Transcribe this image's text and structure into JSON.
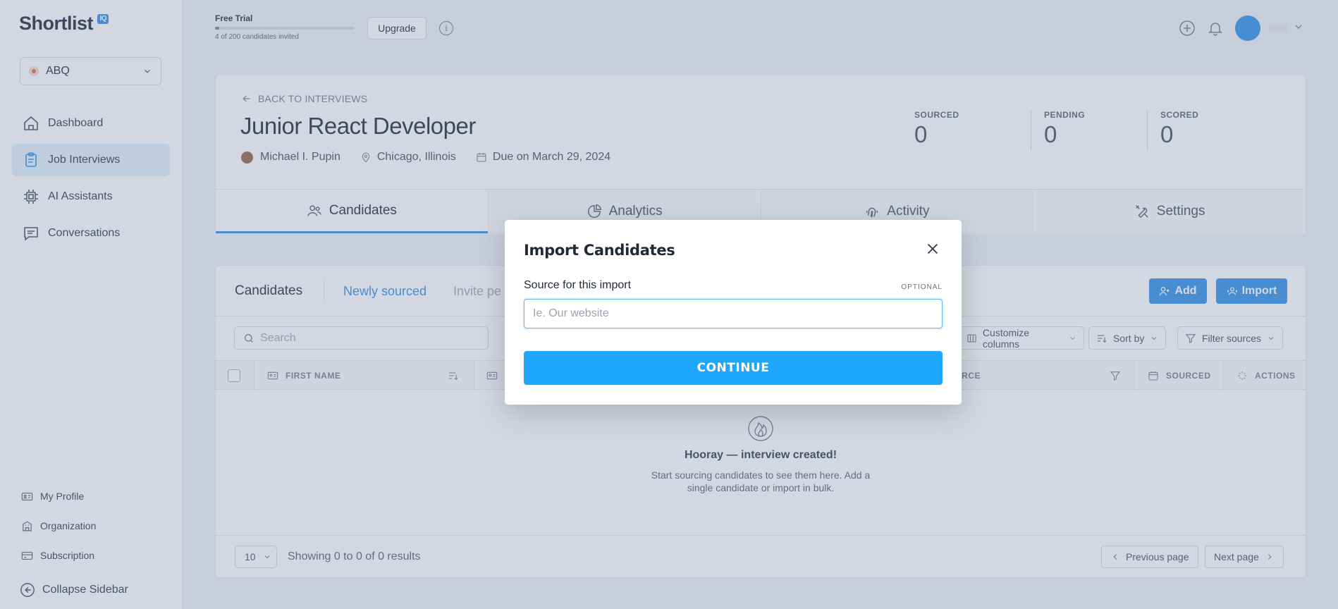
{
  "brand": {
    "name": "Shortlist",
    "badge": "IQ"
  },
  "org": {
    "name": "ABQ"
  },
  "sidebar": {
    "items": [
      {
        "label": "Dashboard",
        "icon": "home-icon"
      },
      {
        "label": "Job Interviews",
        "icon": "clipboard-icon",
        "active": true
      },
      {
        "label": "AI Assistants",
        "icon": "chip-icon"
      },
      {
        "label": "Conversations",
        "icon": "chat-icon"
      }
    ],
    "bottom": [
      {
        "label": "My Profile",
        "icon": "id-card-icon"
      },
      {
        "label": "Organization",
        "icon": "building-icon"
      },
      {
        "label": "Subscription",
        "icon": "credit-card-icon"
      }
    ],
    "collapse_label": "Collapse Sidebar"
  },
  "topbar": {
    "trial_label": "Free Trial",
    "trial_progress": 0.02,
    "trial_sub": "4 of 200 candidates invited",
    "upgrade_label": "Upgrade",
    "info_glyph": "i"
  },
  "job": {
    "back_label": "BACK TO INTERVIEWS",
    "title": "Junior React Developer",
    "owner": "Michael I. Pupin",
    "location": "Chicago, Illinois",
    "due": "Due on March 29, 2024",
    "stats": [
      {
        "label": "SOURCED",
        "value": "0"
      },
      {
        "label": "PENDING",
        "value": "0"
      },
      {
        "label": "SCORED",
        "value": "0"
      }
    ],
    "tabs": [
      {
        "label": "Candidates",
        "icon": "users-icon"
      },
      {
        "label": "Analytics",
        "icon": "pie-chart-icon"
      },
      {
        "label": "Activity",
        "icon": "fingerprint-icon"
      },
      {
        "label": "Settings",
        "icon": "tools-icon"
      }
    ]
  },
  "candidates": {
    "title": "Candidates",
    "subtabs": {
      "newly": "Newly sourced",
      "invite": "Invite pe"
    },
    "add_label": "Add",
    "import_label": "Import",
    "search_placeholder": "Search",
    "customize_label": "Customize columns",
    "sort_label": "Sort by",
    "filter_label": "Filter sources",
    "columns": {
      "first_name": "FIRST NAME",
      "source": "URCE",
      "sourced": "SOURCED",
      "actions": "ACTIONS"
    },
    "empty_title": "Hooray — interview created!",
    "empty_sub": "Start sourcing candidates to see them here. Add a single candidate or import in bulk.",
    "per_page": "10",
    "showing": "Showing 0 to 0 of 0 results",
    "prev_label": "Previous page",
    "next_label": "Next page"
  },
  "modal": {
    "title": "Import Candidates",
    "field_label": "Source for this import",
    "optional": "OPTIONAL",
    "placeholder": "Ie. Our website",
    "value": "",
    "continue_label": "CONTINUE"
  },
  "colors": {
    "accent": "#1e88e5",
    "continue": "#1ea7fd"
  }
}
